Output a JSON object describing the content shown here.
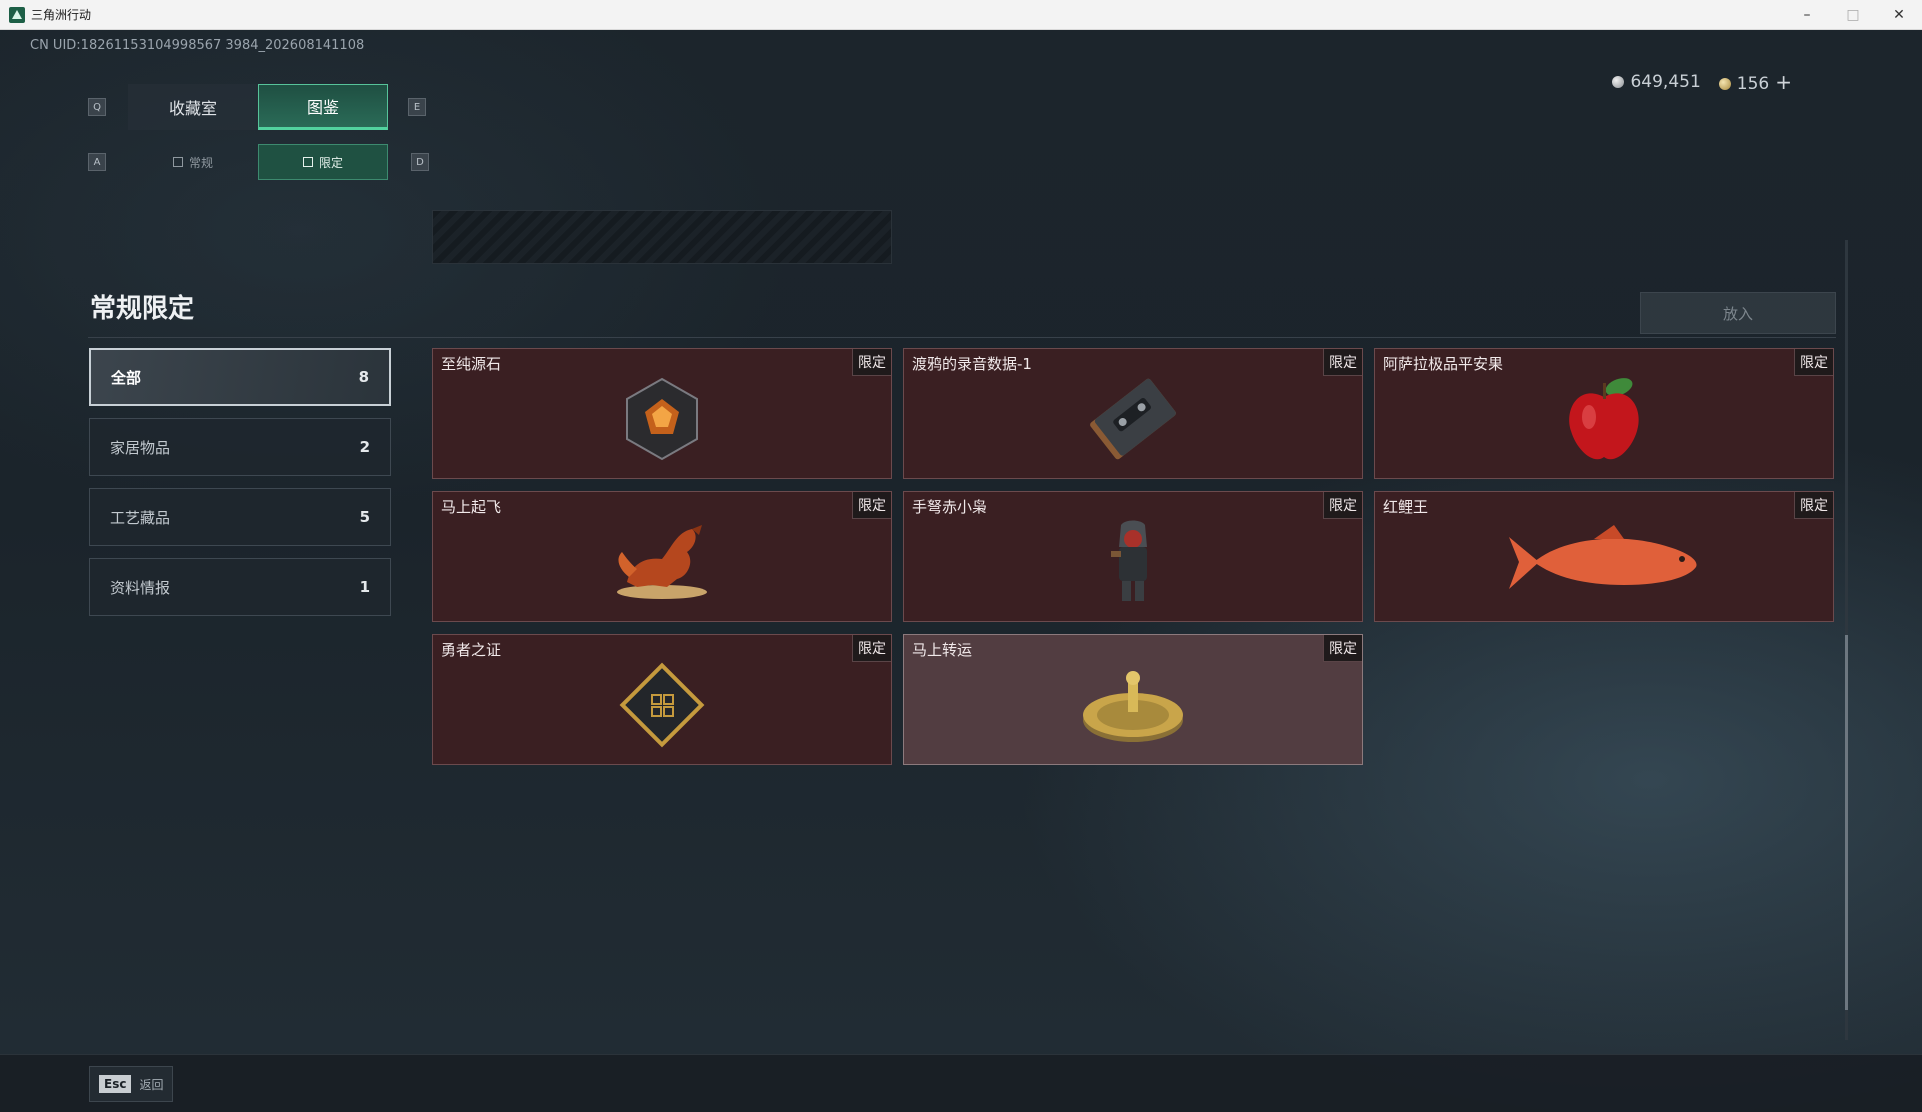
{
  "window": {
    "title": "三角洲行动",
    "minimize": "–",
    "maximize": "□",
    "close": "✕"
  },
  "uid": "CN UID:18261153104998567 3984_202608141108",
  "currency": {
    "silver": "649,451",
    "gold": "156",
    "add": "+"
  },
  "keys": {
    "prev_tab": "Q",
    "next_tab": "E",
    "prev_subtab": "A",
    "next_subtab": "D"
  },
  "tabs": [
    {
      "label": "收藏室",
      "active": false
    },
    {
      "label": "图鉴",
      "active": true
    }
  ],
  "subtabs": [
    {
      "label": "常规",
      "active": false
    },
    {
      "label": "限定",
      "active": true
    }
  ],
  "section": {
    "title": "常规限定",
    "put_button": "放入"
  },
  "categories": [
    {
      "label": "全部",
      "count": "8",
      "active": true
    },
    {
      "label": "家居物品",
      "count": "2",
      "active": false
    },
    {
      "label": "工艺藏品",
      "count": "5",
      "active": false
    },
    {
      "label": "资料情报",
      "count": "1",
      "active": false
    }
  ],
  "items": [
    {
      "name": "至纯源石",
      "tag": "限定",
      "icon": "crystal-stone-icon"
    },
    {
      "name": "渡鸦的录音数据-1",
      "tag": "限定",
      "icon": "cassette-tape-icon"
    },
    {
      "name": "阿萨拉极品平安果",
      "tag": "限定",
      "icon": "apple-icon"
    },
    {
      "name": "马上起飞",
      "tag": "限定",
      "icon": "horse-figurine-icon"
    },
    {
      "name": "手弩赤小枭",
      "tag": "限定",
      "icon": "hooded-figure-icon"
    },
    {
      "name": "红鲤王",
      "tag": "限定",
      "icon": "carp-fish-icon"
    },
    {
      "name": "勇者之证",
      "tag": "限定",
      "icon": "emblem-card-icon"
    },
    {
      "name": "马上转运",
      "tag": "限定",
      "icon": "golden-wheel-icon"
    }
  ],
  "colors": {
    "accent": "#52d39f",
    "card_bg": "#3a1f22",
    "card_selected_bg": "#523d41"
  },
  "bottom": {
    "esc_key": "Esc",
    "back_label": "返回"
  }
}
